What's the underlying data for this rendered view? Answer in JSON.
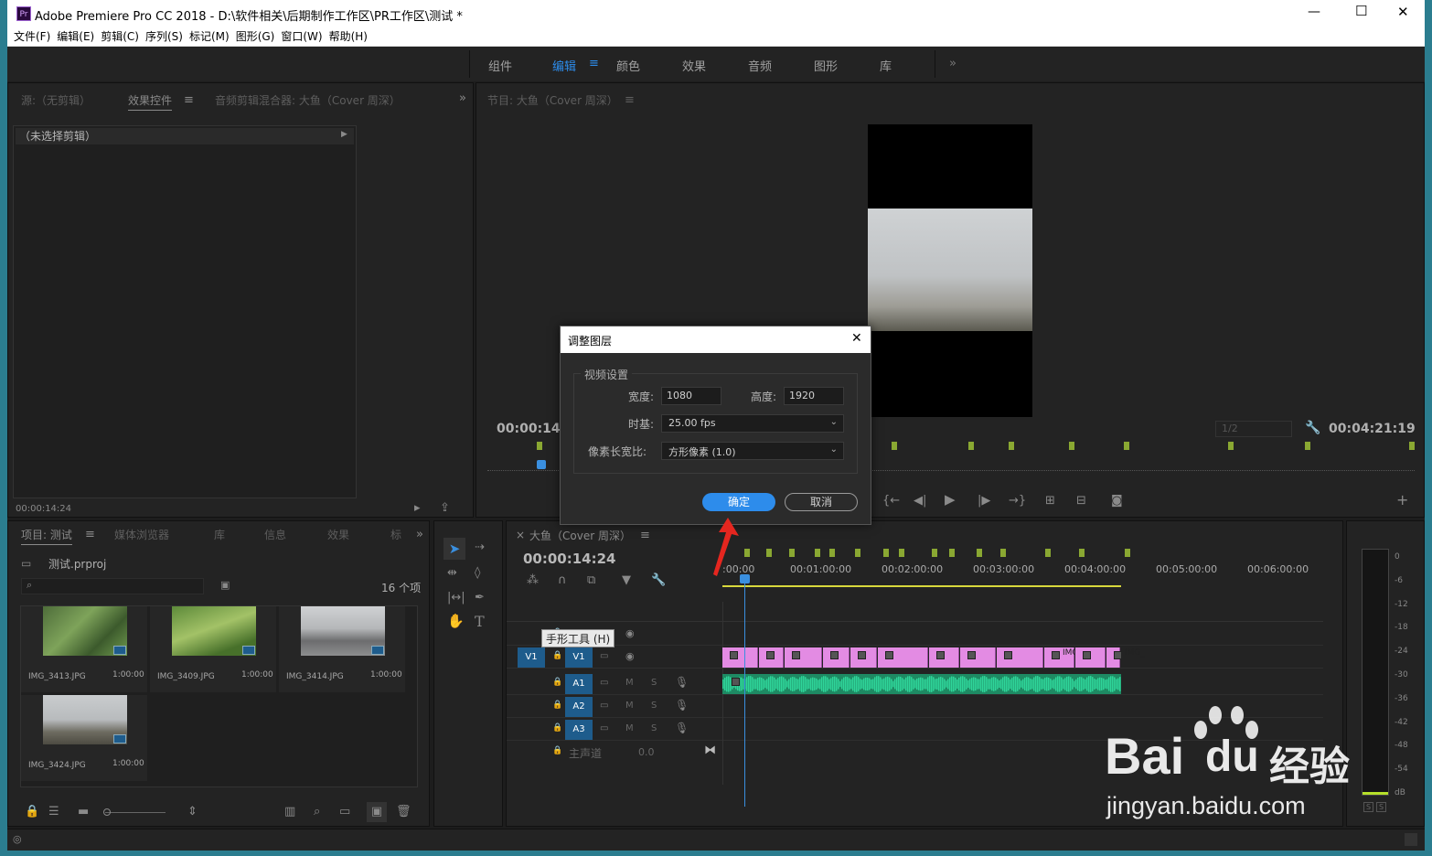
{
  "window": {
    "app_icon": "Pr",
    "title": "Adobe Premiere Pro CC 2018 - D:\\软件相关\\后期制作工作区\\PR工作区\\测试 *",
    "controls": {
      "minimize": "—",
      "maximize": "☐",
      "close": "✕"
    }
  },
  "menu": [
    "文件(F)",
    "编辑(E)",
    "剪辑(C)",
    "序列(S)",
    "标记(M)",
    "图形(G)",
    "窗口(W)",
    "帮助(H)"
  ],
  "workspaces": [
    {
      "label": "组件",
      "active": false
    },
    {
      "label": "编辑",
      "active": true
    },
    {
      "label": "颜色",
      "active": false
    },
    {
      "label": "效果",
      "active": false
    },
    {
      "label": "音频",
      "active": false
    },
    {
      "label": "图形",
      "active": false
    },
    {
      "label": "库",
      "active": false
    }
  ],
  "source_panel": {
    "tabs": [
      "源:（无剪辑）",
      "效果控件",
      "音频剪辑混合器: 大鱼（Cover 周深）"
    ],
    "no_clip": "（未选择剪辑）",
    "timecode": "00:00:14:24"
  },
  "program_panel": {
    "title": "节目: 大鱼（Cover 周深）",
    "timecode_left": "00:00:14:2",
    "resolution": "1/2",
    "timecode_right": "00:04:21:19"
  },
  "project_panel": {
    "tabs": [
      "项目: 测试",
      "媒体浏览器",
      "库",
      "信息",
      "效果",
      "标"
    ],
    "project_file": "测试.prproj",
    "item_count": "16 个项",
    "items": [
      {
        "name": "IMG_3413.JPG",
        "duration": "1:00:00"
      },
      {
        "name": "IMG_3409.JPG",
        "duration": "1:00:00"
      },
      {
        "name": "IMG_3414.JPG",
        "duration": "1:00:00"
      },
      {
        "name": "IMG_3424.JPG",
        "duration": "1:00:00"
      }
    ]
  },
  "timeline": {
    "close": "×",
    "title": "大鱼（Cover 周深）",
    "timecode": "00:00:14:24",
    "ruler": [
      ":00:00",
      "00:01:00:00",
      "00:02:00:00",
      "00:03:00:00",
      "00:04:00:00",
      "00:05:00:00",
      "00:06:00:00"
    ],
    "tooltip": "手形工具 (H)",
    "source_patch": "V1",
    "tracks": {
      "v2": "V2",
      "v1": "V1",
      "a1": "A1",
      "a2": "A2",
      "a3": "A3",
      "master": "主声道",
      "master_value": "0.0",
      "mute": "M",
      "solo": "S",
      "clip_label": "IMG_"
    },
    "clip_count": 12
  },
  "meter": {
    "scale": [
      "0",
      "-6",
      "-12",
      "-18",
      "-24",
      "-30",
      "-36",
      "-42",
      "-48",
      "-54",
      "dB"
    ],
    "solo": "S"
  },
  "dialog": {
    "title": "调整图层",
    "group_label": "视频设置",
    "width_label": "宽度:",
    "width_value": "1080",
    "height_label": "高度:",
    "height_value": "1920",
    "timebase_label": "时基:",
    "timebase_value": "25.00 fps",
    "pixel_label": "像素长宽比:",
    "pixel_value": "方形像素 (1.0)",
    "ok": "确定",
    "cancel": "取消",
    "close": "✕"
  },
  "watermark": {
    "text1": "Bai",
    "text2": "du",
    "text3": "经验",
    "url": "jingyan.baidu.com"
  },
  "colors": {
    "accent": "#2d8ceb",
    "clip_video": "#e38be3",
    "clip_audio": "#2bbf8a",
    "marker": "#8aa832",
    "playhead": "#3a8fdf"
  }
}
